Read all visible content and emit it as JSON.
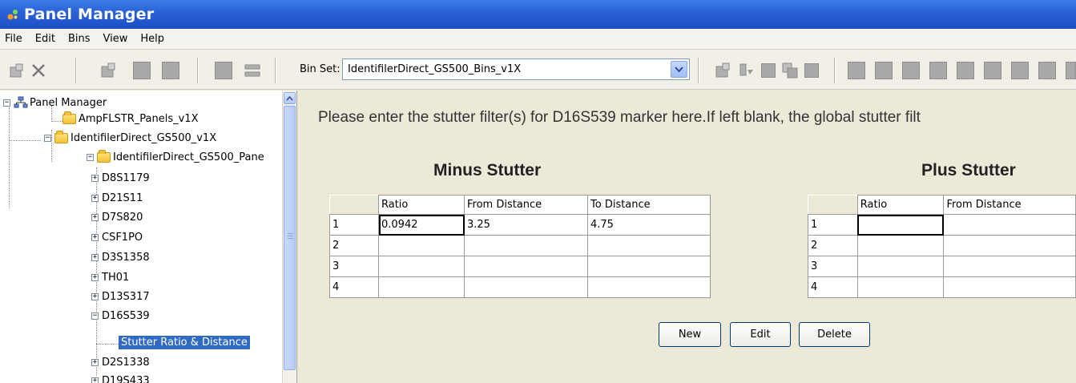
{
  "window": {
    "title": "Panel Manager"
  },
  "menu": [
    "File",
    "Edit",
    "Bins",
    "View",
    "Help"
  ],
  "toolbar": {
    "bin_set_label": "Bin Set:",
    "bin_set_value": "IdentifilerDirect_GS500_Bins_v1X"
  },
  "tree": {
    "root": "Panel Manager",
    "folder1": "AmpFLSTR_Panels_v1X",
    "folder2": "IdentifilerDirect_GS500_v1X",
    "folder3": "IdentifilerDirect_GS500_Pane",
    "markers": [
      "D8S1179",
      "D21S11",
      "D7S820",
      "CSF1PO",
      "D3S1358",
      "TH01",
      "D13S317",
      "D16S539"
    ],
    "selected_leaf": "Stutter Ratio & Distance",
    "after": [
      "D2S1338",
      "D19S433"
    ]
  },
  "main": {
    "instruction": "Please enter the stutter filter(s) for D16S539 marker here.If left blank, the global stutter filt",
    "minus": {
      "title": "Minus Stutter",
      "headers": [
        "Ratio",
        "From Distance",
        "To Distance"
      ],
      "rows": [
        {
          "n": "1",
          "ratio": "0.0942",
          "from": "3.25",
          "to": "4.75"
        },
        {
          "n": "2",
          "ratio": "",
          "from": "",
          "to": ""
        },
        {
          "n": "3",
          "ratio": "",
          "from": "",
          "to": ""
        },
        {
          "n": "4",
          "ratio": "",
          "from": "",
          "to": ""
        }
      ]
    },
    "plus": {
      "title": "Plus Stutter",
      "headers": [
        "Ratio",
        "From Distance"
      ],
      "rows": [
        {
          "n": "1",
          "ratio": "",
          "from": ""
        },
        {
          "n": "2",
          "ratio": "",
          "from": ""
        },
        {
          "n": "3",
          "ratio": "",
          "from": ""
        },
        {
          "n": "4",
          "ratio": "",
          "from": ""
        }
      ]
    },
    "buttons": {
      "new": "New",
      "edit": "Edit",
      "delete": "Delete"
    }
  }
}
